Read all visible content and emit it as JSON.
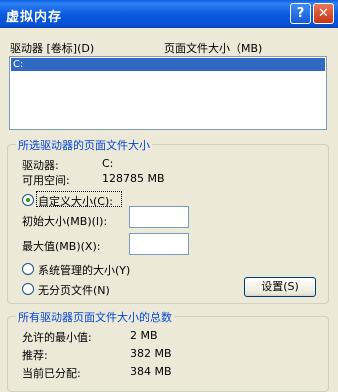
{
  "window": {
    "title": "虚拟内存"
  },
  "titlebar": {
    "help": "?",
    "close": "✕"
  },
  "drive_list": {
    "col_drive": "驱动器 [卷标](D)",
    "col_size": "页面文件大小（MB)",
    "items": [
      "C:"
    ]
  },
  "selected_drive": {
    "group_label": "所选驱动器的页面文件大小",
    "drive_label": "驱动器:",
    "drive_value": "C:",
    "space_label": "可用空间:",
    "space_value": "128785 MB",
    "custom_size": "自定义大小(C):",
    "initial_size_label": "初始大小(MB)(I):",
    "initial_size_value": "",
    "max_size_label": "最大值(MB)(X):",
    "max_size_value": "",
    "system_managed": "系统管理的大小(Y)",
    "no_paging": "无分页文件(N)",
    "set_button": "设置(S)",
    "selected_option": "custom"
  },
  "total": {
    "group_label": "所有驱动器页面文件大小的总数",
    "min_label": "允许的最小值:",
    "min_value": "2 MB",
    "recommended_label": "推荐:",
    "recommended_value": "382 MB",
    "current_label": "当前已分配:",
    "current_value": "384 MB"
  },
  "colors": {
    "titlebar": "#0a5adf",
    "dialog_bg": "#ece9d8",
    "group_label": "#0046d5",
    "selection": "#316ac5"
  }
}
